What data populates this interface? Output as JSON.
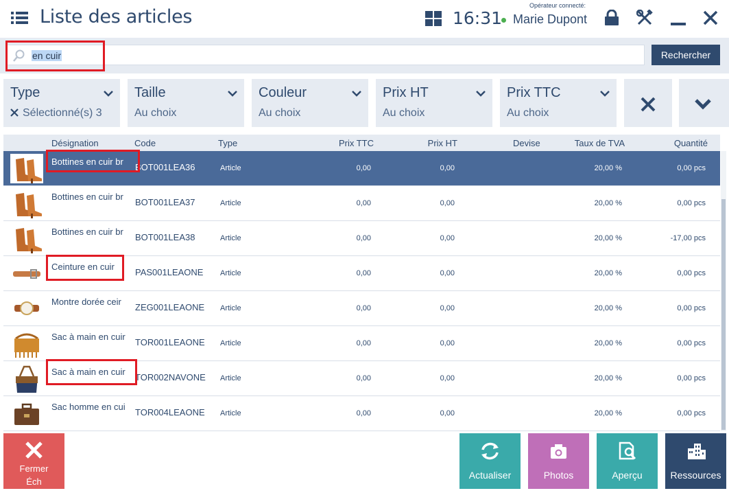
{
  "header": {
    "title": "Liste des articles",
    "time": "16:31",
    "operator_label": "Opérateur connecté:",
    "operator_name": "Marie Dupont",
    "status_color": "#4caf50"
  },
  "search": {
    "value": "en cuir",
    "button_label": "Rechercher"
  },
  "filters": [
    {
      "title": "Type",
      "subtitle": "Sélectionné(s) 3"
    },
    {
      "title": "Taille",
      "subtitle": "Au choix"
    },
    {
      "title": "Couleur",
      "subtitle": "Au choix"
    },
    {
      "title": "Prix HT",
      "subtitle": "Au choix"
    },
    {
      "title": "Prix TTC",
      "subtitle": "Au choix"
    }
  ],
  "table": {
    "columns": [
      "Désignation",
      "Code",
      "Type",
      "Prix TTC",
      "Prix HT",
      "Devise",
      "Taux de TVA",
      "Quantité"
    ],
    "rows": [
      {
        "name": "Bottines en cuir br",
        "code": "BOT001LEA36",
        "type": "Article",
        "ttc": "0,00",
        "ht": "0,00",
        "currency": "",
        "vat": "20,00 %",
        "qty": "0,00 pcs",
        "icon": "ankle-boots-icon"
      },
      {
        "name": "Bottines en cuir br",
        "code": "BOT001LEA37",
        "type": "Article",
        "ttc": "0,00",
        "ht": "0,00",
        "currency": "",
        "vat": "20,00 %",
        "qty": "0,00 pcs",
        "icon": "ankle-boots-icon"
      },
      {
        "name": "Bottines en cuir br",
        "code": "BOT001LEA38",
        "type": "Article",
        "ttc": "0,00",
        "ht": "0,00",
        "currency": "",
        "vat": "20,00 %",
        "qty": "-17,00 pcs",
        "icon": "ankle-boots-icon"
      },
      {
        "name": "Ceinture en cuir",
        "code": "PAS001LEAONE",
        "type": "Article",
        "ttc": "0,00",
        "ht": "0,00",
        "currency": "",
        "vat": "20,00 %",
        "qty": "0,00 pcs",
        "icon": "belt-icon"
      },
      {
        "name": "Montre dorée ceir",
        "code": "ZEG001LEAONE",
        "type": "Article",
        "ttc": "0,00",
        "ht": "0,00",
        "currency": "",
        "vat": "20,00 %",
        "qty": "0,00 pcs",
        "icon": "watch-icon"
      },
      {
        "name": "Sac à main en cuir",
        "code": "TOR001LEAONE",
        "type": "Article",
        "ttc": "0,00",
        "ht": "0,00",
        "currency": "",
        "vat": "20,00 %",
        "qty": "0,00 pcs",
        "icon": "fringe-bag-icon"
      },
      {
        "name": "Sac à main en cuir",
        "code": "TOR002NAVONE",
        "type": "Article",
        "ttc": "0,00",
        "ht": "0,00",
        "currency": "",
        "vat": "20,00 %",
        "qty": "0,00 pcs",
        "icon": "handbag-icon"
      },
      {
        "name": "Sac homme en cui",
        "code": "TOR004LEAONE",
        "type": "Article",
        "ttc": "0,00",
        "ht": "0,00",
        "currency": "",
        "vat": "20,00 %",
        "qty": "0,00 pcs",
        "icon": "briefcase-icon"
      }
    ],
    "selected_index": 0,
    "selected_color": "#4a6a99"
  },
  "bottom": {
    "close_label_1": "Fermer",
    "close_label_2": "Éch",
    "refresh_label": "Actualiser",
    "photos_label": "Photos",
    "preview_label": "Aperçu",
    "resources_label": "Ressources"
  },
  "colors": {
    "primary": "#2f4a6e",
    "panel": "#e6ebf2",
    "danger": "#e05a5a",
    "teal": "#3aaaaa",
    "purple": "#bf6fb8",
    "annotation": "#e01b24"
  }
}
